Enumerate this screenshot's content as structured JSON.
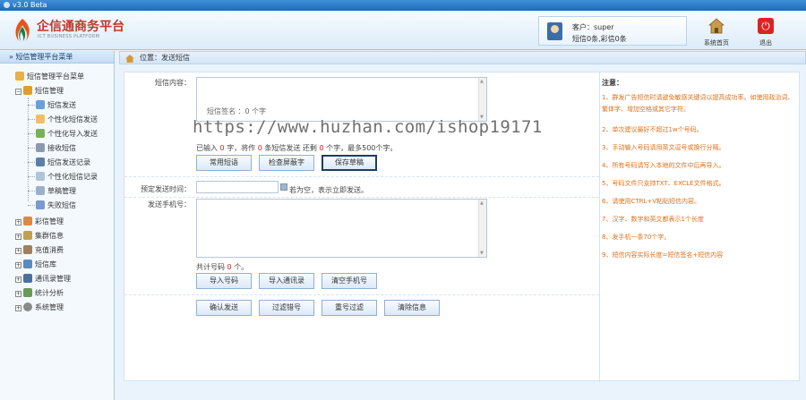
{
  "titlebar": {
    "title": "v3.0 Beta"
  },
  "header": {
    "brand": "企信通商务平台",
    "brand_sub": "ICT BUSINESS PLATFORM",
    "user_line": "客户：super",
    "quota_line": "短信0条,彩信0条",
    "home_label": "系统首页",
    "exit_label": "退出"
  },
  "sidebar": {
    "header": "» 短信管理平台菜单",
    "root": "短信管理平台菜单",
    "sms_group": "短信管理",
    "items": [
      "短信发送",
      "个性化短信发送",
      "个性化导入发送",
      "接收短信",
      "短信发送记录",
      "个性化短信记录",
      "草稿管理",
      "失败短信"
    ],
    "groups": [
      "彩信管理",
      "集群信息",
      "充值消费",
      "短信库",
      "通讯录管理",
      "统计分析",
      "系统管理"
    ]
  },
  "breadcrumb": "位置：发送短信",
  "form": {
    "content_label": "短信内容：",
    "signature_hint": "短信签名 ：0 个字",
    "count_prefix": "已输入",
    "count_value": "0",
    "count_mid1": "字，将作",
    "count_parts": "0",
    "count_mid2": "条短信发送  还剩",
    "count_remain": "0",
    "count_suffix": "个字，最多500个字。",
    "btn_common": "常用短语",
    "btn_check": "检查屏蔽字",
    "btn_save": "保存草稿",
    "schedule_label": "预定发送时间：",
    "schedule_hint": "若为空，表示立即发送。",
    "mobile_label": "发送手机号：",
    "total_prefix": "共计号码",
    "total_value": "0",
    "total_suffix": "个。",
    "btn_import": "导入号码",
    "btn_contacts": "导入通讯录",
    "btn_clear": "清空手机号",
    "btn_send": "确认发送",
    "btn_filter_err": "过滤错号",
    "btn_filter_dup": "重号过滤",
    "btn_reset": "清除信息"
  },
  "notes": {
    "title": "注意：",
    "items": [
      "1、群发广告短信时请避免敏感关键词以提高成功率。如使用政治词、繁体字、增加空格或其它字符。",
      "2、单次建议最好不超过1w个号码。",
      "3、手动输入号码请用英文逗号或换行分隔。",
      "4、所有号码请写入本地的文件中后再导入。",
      "5、号码文件只支持TXT、EXCLE文件格式。",
      "6、请使用CTRL+V粘贴短信内容。",
      "7、汉字、数字和英文都表示1个长度",
      "8、发手机一条70个字。",
      "9、短信内容实际长度=短信签名+短信内容"
    ]
  },
  "watermark": "https://www.huzhan.com/ishop19171",
  "colors": {
    "accent": "#1d6bbb",
    "notes": "#e0701a",
    "count": "#e02020"
  }
}
